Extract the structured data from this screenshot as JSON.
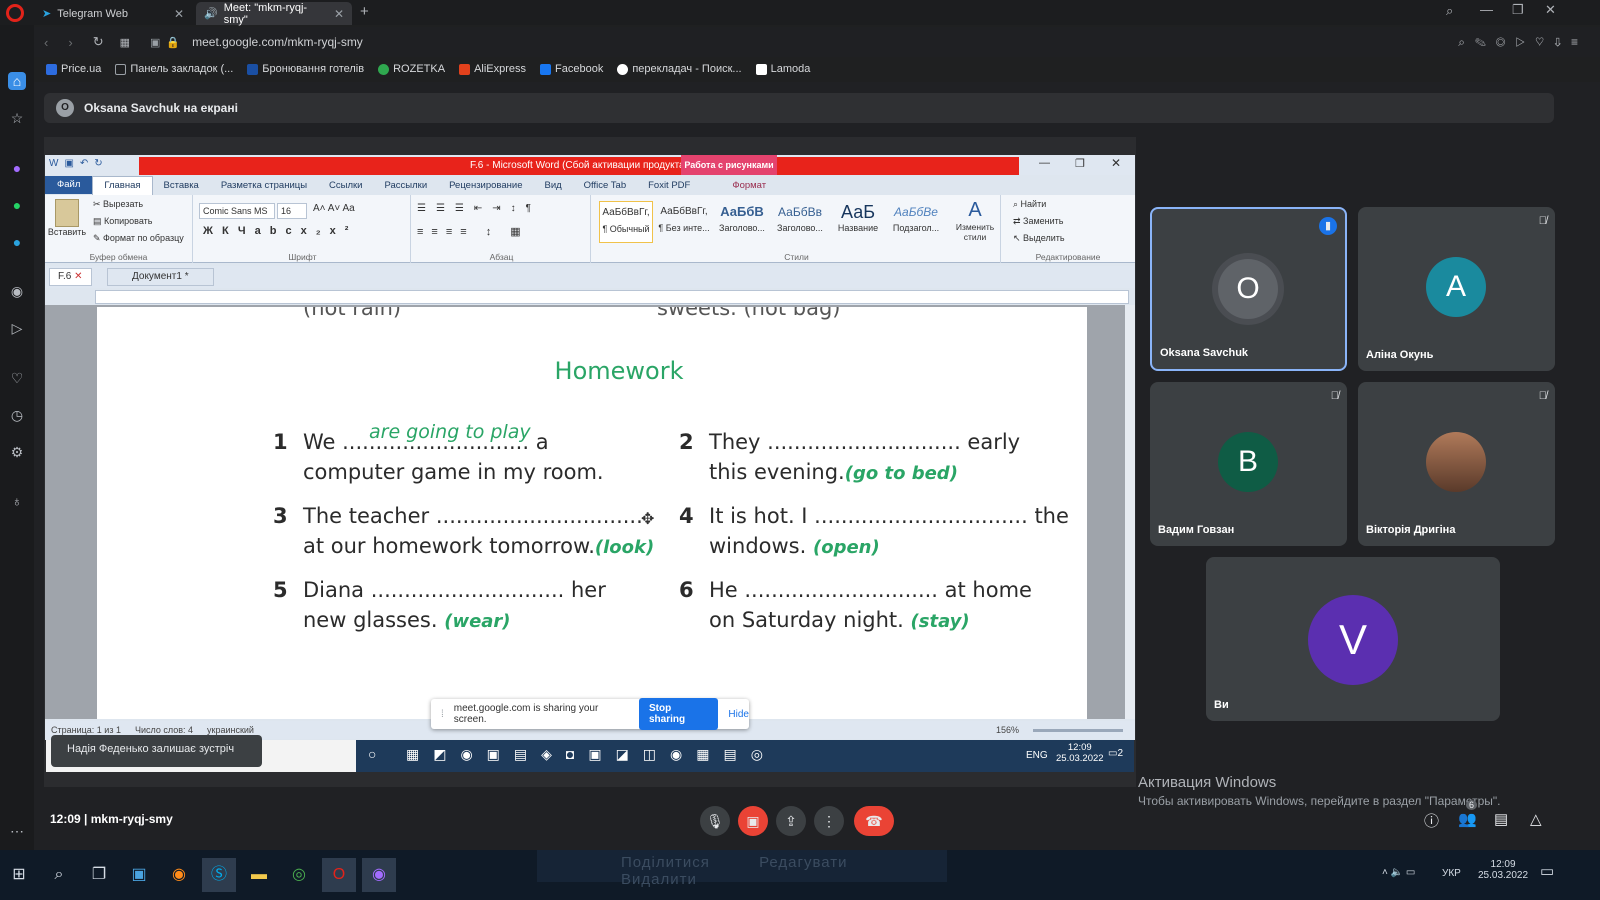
{
  "browser": {
    "tabs": [
      {
        "label": "Telegram Web"
      },
      {
        "label": "Meet: \"mkm-ryqj-smy\""
      }
    ],
    "url": "meet.google.com/mkm-ryqj-smy",
    "bookmarks": [
      {
        "label": "Price.ua",
        "color": "#2d6cdf"
      },
      {
        "label": "Панель закладок (...",
        "color": "#9aa0a6"
      },
      {
        "label": "Бронювання готелів",
        "color": "#1a4fa3"
      },
      {
        "label": "ROZETKA",
        "color": "#2fa84f"
      },
      {
        "label": "AliExpress",
        "color": "#e2411c"
      },
      {
        "label": "Facebook",
        "color": "#1877f2"
      },
      {
        "label": "перекладач - Поиск...",
        "color": "#ffffff"
      },
      {
        "label": "Lamoda",
        "color": "#222222"
      }
    ]
  },
  "meet": {
    "presenter_label": "Oksana Savchuk на екрані",
    "presenter_initial": "O",
    "toast": "Надія Феденько залишає зустріч",
    "time": "12:09",
    "meeting_code": "mkm-ryqj-smy",
    "participant_count": "6",
    "participants": [
      {
        "name": "Oksana Savchuk",
        "initial": "O",
        "color": "#5f6368",
        "speaking": true
      },
      {
        "name": "Аліна Окунь",
        "initial": "A",
        "color": "#1a8a9e"
      },
      {
        "name": "Вадим Говзан",
        "initial": "B",
        "color": "#0f5c45"
      },
      {
        "name": "Вікторія Дригіна",
        "initial": "",
        "color": "#7a4a3a"
      },
      {
        "name": "Ви",
        "initial": "V",
        "color": "#5b2fb0"
      }
    ],
    "share_banner": {
      "text": "meet.google.com is sharing your screen.",
      "stop": "Stop sharing",
      "hide": "Hide"
    }
  },
  "word": {
    "title": "F.6 - Microsoft Word (Сбой активации продукта)",
    "context_tab": "Работа с рисунками",
    "ribbon_tabs": [
      "Файл",
      "Главная",
      "Вставка",
      "Разметка страницы",
      "Ссылки",
      "Рассылки",
      "Рецензирование",
      "Вид",
      "Office Tab",
      "Foxit PDF",
      "Формат"
    ],
    "clipboard": {
      "paste": "Вставить",
      "cut": "Вырезать",
      "copy": "Копировать",
      "format": "Формат по образцу",
      "label": "Буфер обмена"
    },
    "font": {
      "name": "Comic Sans MS",
      "size": "16",
      "label": "Шрифт"
    },
    "paragraph_label": "Абзац",
    "styles": [
      {
        "preview": "АаБбВвГг,",
        "name": "¶ Обычный"
      },
      {
        "preview": "АаБбВвГг,",
        "name": "¶ Без инте..."
      },
      {
        "preview": "АаБбВ",
        "name": "Заголово..."
      },
      {
        "preview": "АаБбВв",
        "name": "Заголово..."
      },
      {
        "preview": "АаБ",
        "name": "Название"
      },
      {
        "preview": "АаБбВе",
        "name": "Подзагол..."
      }
    ],
    "styles_label": "Стили",
    "change_styles": "Изменить стили",
    "editing": {
      "find": "Найти",
      "replace": "Заменить",
      "select": "Выделить",
      "label": "Редактирование"
    },
    "doc_tabs": [
      "F.6",
      "Документ1 *"
    ],
    "status": {
      "page": "Страница: 1 из 1",
      "words": "Число слов: 4",
      "lang": "украинский",
      "zoom": "156%"
    },
    "document": {
      "top_left": "(not rain)",
      "top_right": "sweets. (not bag)",
      "heading": "Homework",
      "exercises": [
        {
          "n": "1",
          "line1": "We ............................ a",
          "answer": "are going to play",
          "line2": "computer game in my room.",
          "hint": ""
        },
        {
          "n": "2",
          "line1": "They ............................. early",
          "answer": "",
          "line2": "this evening.",
          "hint": "(go to bed)"
        },
        {
          "n": "3",
          "line1": "The teacher ...............................",
          "answer": "",
          "line2": "at our homework tomorrow.",
          "hint": "(look)"
        },
        {
          "n": "4",
          "line1": "It is hot. I ................................ the",
          "answer": "",
          "line2": "windows.",
          "hint": "(open)"
        },
        {
          "n": "5",
          "line1": "Diana ............................. her",
          "answer": "",
          "line2": "new glasses.",
          "hint": "(wear)"
        },
        {
          "n": "6",
          "line1": "He ............................. at home",
          "answer": "",
          "line2": "on Saturday night.",
          "hint": "(stay)"
        }
      ]
    }
  },
  "inner_taskbar": {
    "lang": "ENG",
    "time": "12:09",
    "date": "25.03.2022",
    "notif": "2"
  },
  "windows_activation": {
    "title": "Активация Windows",
    "text": "Чтобы активировать Windows, перейдите в раздел \"Параметры\"."
  },
  "bottom_ghost": [
    "Поділитися",
    "Редагувати",
    "Видалити"
  ],
  "os_taskbar": {
    "lang": "УКР",
    "time": "12:09",
    "date": "25.03.2022"
  }
}
